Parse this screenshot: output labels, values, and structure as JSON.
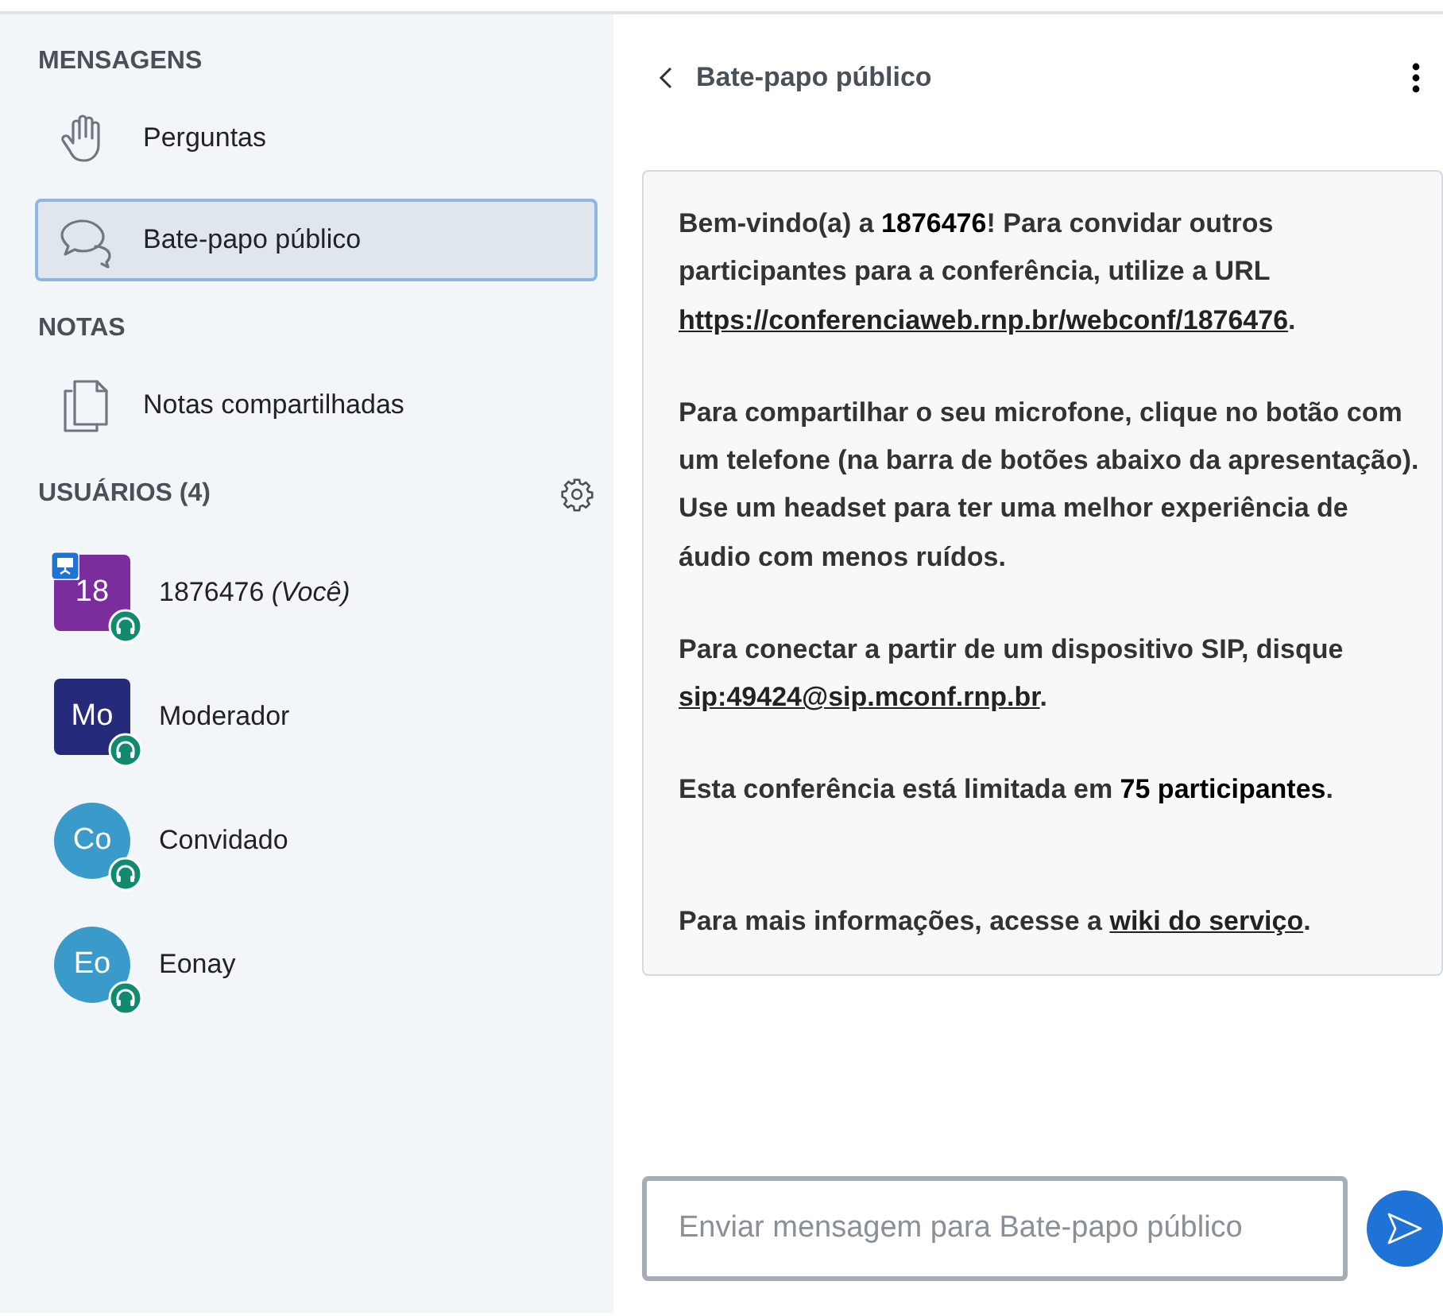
{
  "sidebar": {
    "sections": [
      {
        "kind": "nav",
        "title": "MENSAGENS",
        "items": [
          {
            "kind": "questions",
            "label": "Perguntas",
            "selected": false
          },
          {
            "kind": "chat",
            "label": "Bate-papo público",
            "selected": true
          }
        ]
      },
      {
        "kind": "nav",
        "title": "NOTAS",
        "items": [
          {
            "kind": "notes",
            "label": "Notas compartilhadas",
            "selected": false
          }
        ]
      },
      {
        "kind": "users",
        "title": "USUÁRIOS (4)",
        "users": [
          {
            "initials": "18",
            "name": "1876476 *(Você)*",
            "kind": "moderator",
            "color": "#7b2d9e",
            "presenter": true,
            "audio": true
          },
          {
            "initials": "Mo",
            "name": "Moderador",
            "kind": "moderator",
            "color": "#262a7a",
            "presenter": false,
            "audio": true
          },
          {
            "initials": "Co",
            "name": "Convidado",
            "kind": "viewer",
            "color": "#3a9ac9",
            "presenter": false,
            "audio": true
          },
          {
            "initials": "Eo",
            "name": "Eonay",
            "kind": "viewer",
            "color": "#3a9ac9",
            "presenter": false,
            "audio": true
          }
        ]
      }
    ]
  },
  "chat": {
    "title": "Bate-papo público",
    "message": [
      [
        {
          "kind": "text",
          "text": "Bem-vindo(a) a **1876476**! Para convidar outros participantes para a conferência, utilize a URL "
        },
        {
          "kind": "link",
          "text": "https://conferenciaweb.rnp.br/webconf/1876476"
        },
        {
          "kind": "text",
          "text": "."
        }
      ],
      [
        {
          "kind": "text",
          "text": "Para compartilhar o seu microfone, clique no botão com um telefone (na barra de botões abaixo da apresentação). Use um headset para ter uma melhor experiência de áudio com menos ruídos."
        }
      ],
      [
        {
          "kind": "text",
          "text": "Para conectar a partir de um dispositivo SIP, disque "
        },
        {
          "kind": "link",
          "text": "sip:49424@sip.mconf.rnp.br"
        },
        {
          "kind": "text",
          "text": "."
        }
      ],
      [
        {
          "kind": "text",
          "text": "Esta conferência está limitada em **75 participantes**."
        }
      ],
      [
        {
          "kind": "text",
          "text": "Para mais informações, acesse a "
        },
        {
          "kind": "link",
          "text": "wiki do serviço"
        },
        {
          "kind": "text",
          "text": "."
        }
      ]
    ],
    "input": {
      "placeholder": "Enviar mensagem para Bate-papo público"
    }
  }
}
